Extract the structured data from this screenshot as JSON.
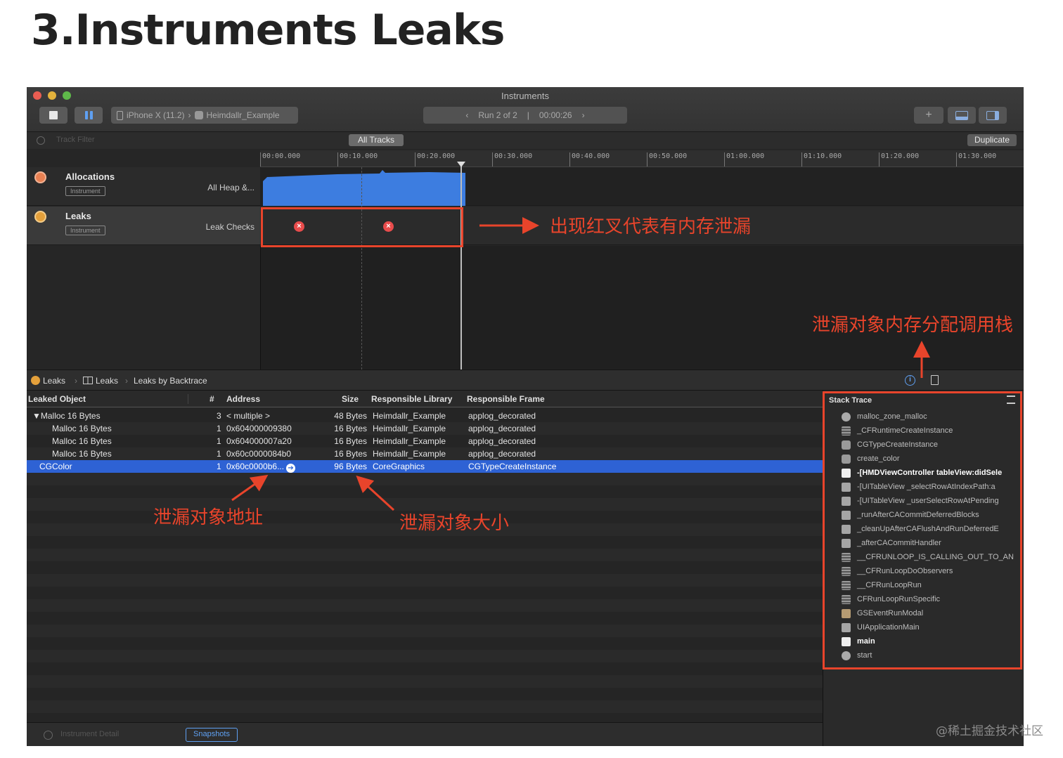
{
  "slide": {
    "title": "3.Instruments Leaks",
    "credit": "@稀土掘金技术社区"
  },
  "window": {
    "title": "Instruments",
    "target_device": "iPhone X (11.2)",
    "target_app": "Heimdallr_Example",
    "run_label": "Run 2 of 2",
    "run_sep": "|",
    "run_time": "00:00:26",
    "add_icon": "+",
    "filter_placeholder": "Track Filter",
    "all_tracks": "All Tracks",
    "duplicate": "Duplicate"
  },
  "ruler": [
    "00:00.000",
    "00:10.000",
    "00:20.000",
    "00:30.000",
    "00:40.000",
    "00:50.000",
    "01:00.000",
    "01:10.000",
    "01:20.000",
    "01:30.000"
  ],
  "tracks": [
    {
      "name": "Allocations",
      "badge": "Instrument",
      "detail": "All Heap &..."
    },
    {
      "name": "Leaks",
      "badge": "Instrument",
      "detail": "Leak Checks"
    }
  ],
  "annotations": {
    "leak_marker": "出现红叉代表有内存泄漏",
    "call_stack": "泄漏对象内存分配调用栈",
    "address": "泄漏对象地址",
    "size": "泄漏对象大小"
  },
  "nav": {
    "item1": "Leaks",
    "item2": "Leaks",
    "item3": "Leaks by Backtrace",
    "sep": "›"
  },
  "table": {
    "headers": {
      "leaked_object": "Leaked Object",
      "count": "#",
      "address": "Address",
      "size": "Size",
      "library": "Responsible Library",
      "frame": "Responsible Frame"
    },
    "rows": [
      {
        "object": "▼Malloc 16 Bytes",
        "count": "3",
        "address": "< multiple >",
        "size": "48 Bytes",
        "library": "Heimdallr_Example",
        "frame": "applog_decorated"
      },
      {
        "object": "Malloc 16 Bytes",
        "count": "1",
        "address": "0x604000009380",
        "size": "16 Bytes",
        "library": "Heimdallr_Example",
        "frame": "applog_decorated"
      },
      {
        "object": "Malloc 16 Bytes",
        "count": "1",
        "address": "0x604000007a20",
        "size": "16 Bytes",
        "library": "Heimdallr_Example",
        "frame": "applog_decorated"
      },
      {
        "object": "Malloc 16 Bytes",
        "count": "1",
        "address": "0x60c0000084b0",
        "size": "16 Bytes",
        "library": "Heimdallr_Example",
        "frame": "applog_decorated"
      },
      {
        "object": "CGColor",
        "count": "1",
        "address": "0x60c0000b6...",
        "size": "96 Bytes",
        "library": "CoreGraphics",
        "frame": "CGTypeCreateInstance"
      }
    ]
  },
  "stack_trace": {
    "title": "Stack Trace",
    "frames": [
      {
        "name": "malloc_zone_malloc",
        "icon": "gear-icon"
      },
      {
        "name": "_CFRuntimeCreateInstance",
        "icon": "library-icon"
      },
      {
        "name": "CGTypeCreateInstance",
        "icon": "coregraphics-icon"
      },
      {
        "name": "create_color",
        "icon": "coregraphics-icon"
      },
      {
        "name": "-[HMDViewController tableView:didSele",
        "icon": "user-icon"
      },
      {
        "name": "-[UITableView _selectRowAtIndexPath:a",
        "icon": "uikit-icon"
      },
      {
        "name": "-[UITableView _userSelectRowAtPending",
        "icon": "uikit-icon"
      },
      {
        "name": "_runAfterCACommitDeferredBlocks",
        "icon": "uikit-icon"
      },
      {
        "name": "_cleanUpAfterCAFlushAndRunDeferredE",
        "icon": "uikit-icon"
      },
      {
        "name": "_afterCACommitHandler",
        "icon": "uikit-icon"
      },
      {
        "name": "__CFRUNLOOP_IS_CALLING_OUT_TO_AN",
        "icon": "library-icon"
      },
      {
        "name": "__CFRunLoopDoObservers",
        "icon": "library-icon"
      },
      {
        "name": "__CFRunLoopRun",
        "icon": "library-icon"
      },
      {
        "name": "CFRunLoopRunSpecific",
        "icon": "library-icon"
      },
      {
        "name": "GSEventRunModal",
        "icon": "graphicsservices-icon"
      },
      {
        "name": "UIApplicationMain",
        "icon": "uikit-icon"
      },
      {
        "name": "main",
        "icon": "user-icon"
      },
      {
        "name": "start",
        "icon": "gear-icon"
      }
    ]
  },
  "bottom": {
    "filter": "Instrument Detail",
    "snapshots": "Snapshots"
  },
  "colors": {
    "annotation_red": "#e8442b",
    "selection_blue": "#2e62d4",
    "allocation_blue": "#3d7de0"
  }
}
